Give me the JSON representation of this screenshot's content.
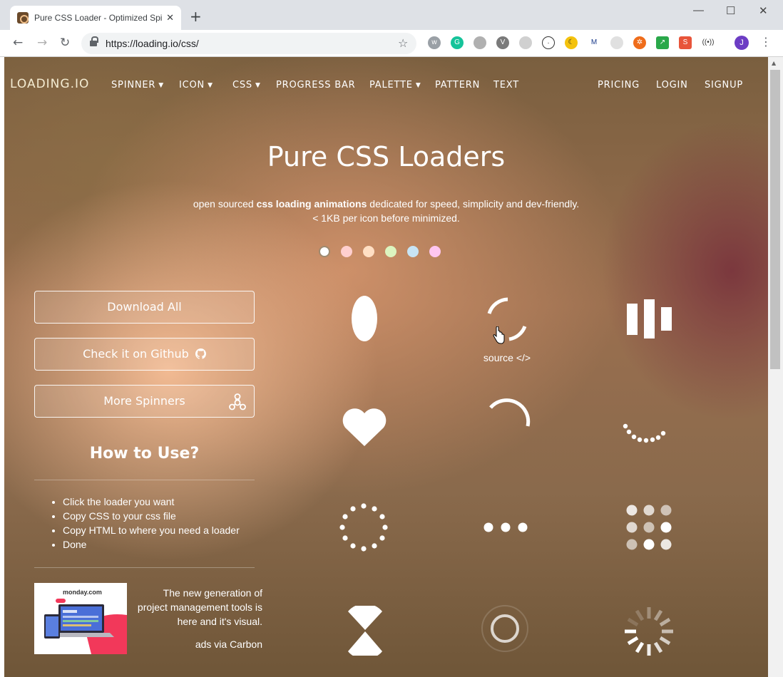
{
  "browser": {
    "tab_title": "Pure CSS Loader - Optimized Spi",
    "url": "https://loading.io/css/",
    "profile_initial": "J"
  },
  "nav": {
    "brand": "LOADING.IO",
    "items": [
      {
        "label": "SPINNER",
        "dropdown": true
      },
      {
        "label": "ICON",
        "dropdown": true
      },
      {
        "label": "CSS",
        "dropdown": true
      },
      {
        "label": "PROGRESS BAR",
        "dropdown": false
      },
      {
        "label": "PALETTE",
        "dropdown": true
      },
      {
        "label": "PATTERN",
        "dropdown": false
      },
      {
        "label": "TEXT",
        "dropdown": false
      }
    ],
    "right": [
      {
        "label": "PRICING"
      },
      {
        "label": "LOGIN"
      },
      {
        "label": "SIGNUP"
      }
    ]
  },
  "hero": {
    "title": "Pure CSS Loaders",
    "subtitle_prefix": "open sourced ",
    "subtitle_bold": "css loading animations",
    "subtitle_suffix": " dedicated for speed, simplicity and dev-friendly.",
    "subtitle_line2": "< 1KB per icon before minimized."
  },
  "palette_dots": [
    "#ffffff",
    "#ffcfcf",
    "#ffdfc4",
    "#dcf5c0",
    "#c7e4f5",
    "#ffc6f0"
  ],
  "buttons": {
    "download": "Download All",
    "github": "Check it on Github",
    "more": "More Spinners"
  },
  "howto": {
    "title": "How to Use?",
    "steps": [
      "Click the loader you want",
      "Copy CSS to your css file",
      "Copy HTML to where you need a loader",
      "Done"
    ]
  },
  "ad": {
    "text": "The new generation of project management tools is here and it's visual.",
    "via": "ads via Carbon",
    "logo_text": "monday.com"
  },
  "loaders": {
    "source_label": "source </>",
    "names": [
      "circle",
      "dual-ring",
      "facebook",
      "heart",
      "ring",
      "roller",
      "default",
      "ellipsis",
      "grid",
      "hourglass",
      "ripple",
      "spinner"
    ]
  }
}
